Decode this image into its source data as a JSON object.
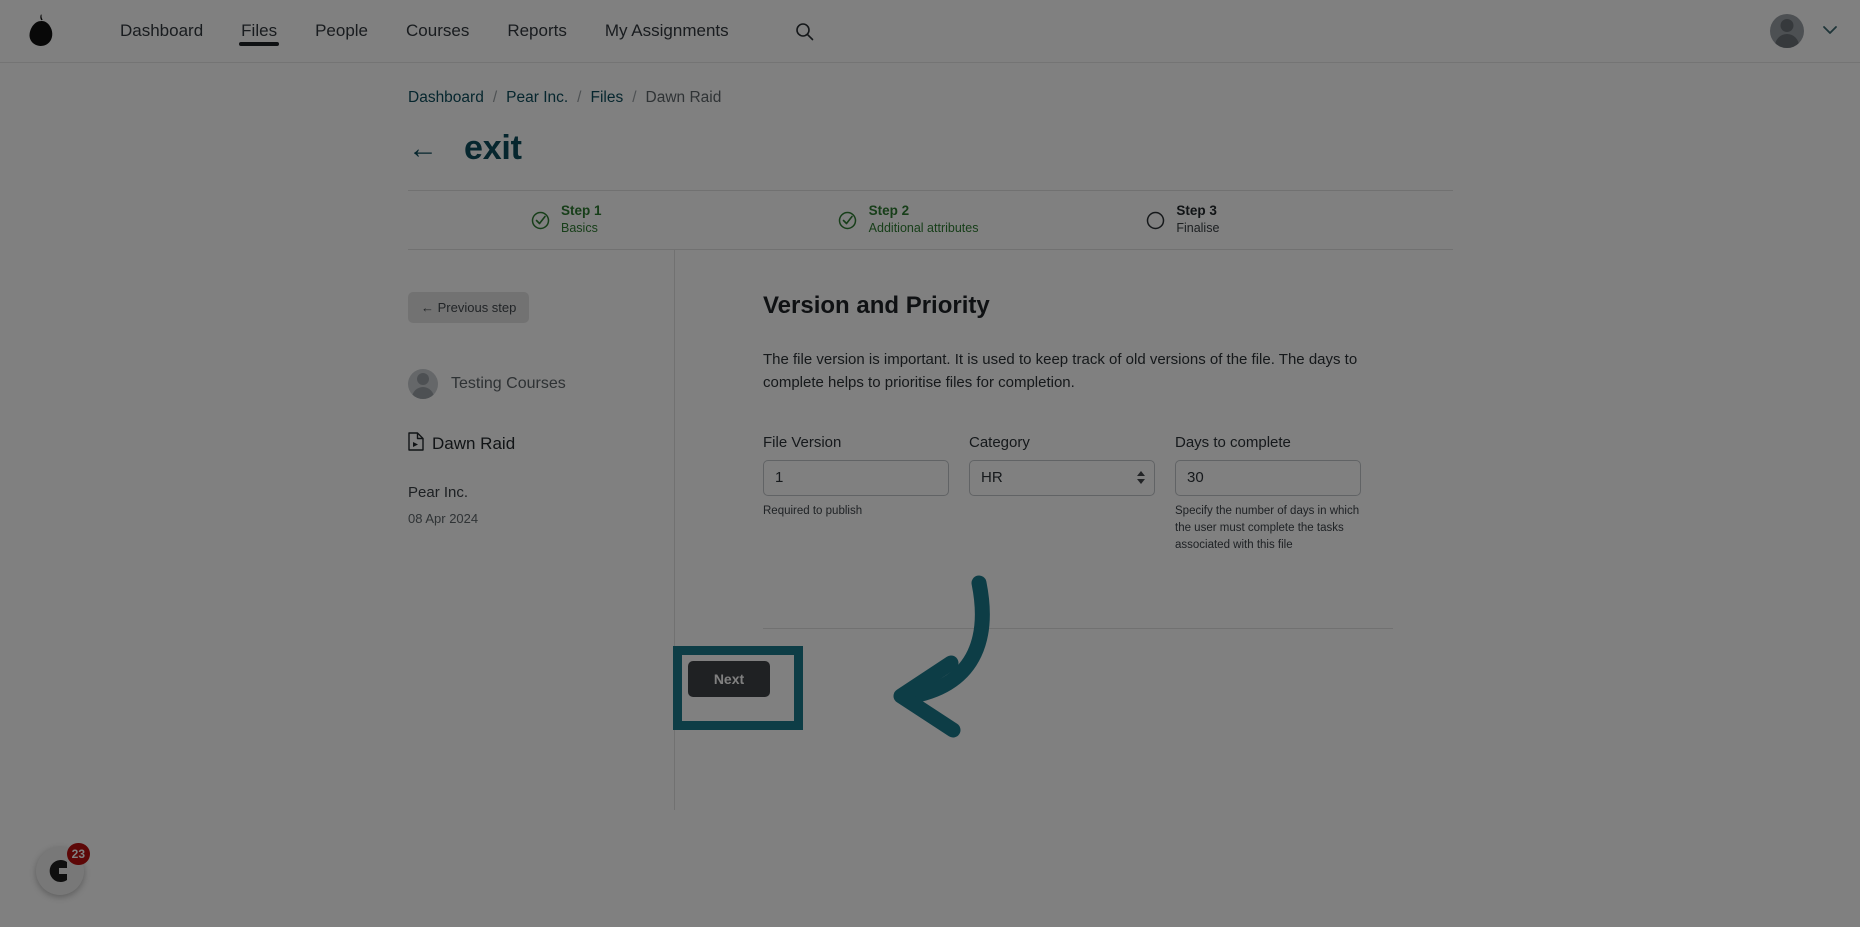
{
  "topnav": {
    "logo_icon": "pear-logo",
    "items": [
      {
        "label": "Dashboard",
        "active": false
      },
      {
        "label": "Files",
        "active": true
      },
      {
        "label": "People",
        "active": false
      },
      {
        "label": "Courses",
        "active": false
      },
      {
        "label": "Reports",
        "active": false
      },
      {
        "label": "My Assignments",
        "active": false
      }
    ],
    "search_icon": "search-icon",
    "account_icon": "user-avatar",
    "account_caret": "chevron-down-icon"
  },
  "breadcrumb": {
    "items": [
      "Dashboard",
      "Pear Inc.",
      "Files",
      "Dawn Raid"
    ],
    "separator": "/"
  },
  "header": {
    "back_arrow": "←",
    "title": "exit"
  },
  "stepper": {
    "steps": [
      {
        "number": "Step 1",
        "label": "Basics",
        "state": "done",
        "icon": "check-circle-icon"
      },
      {
        "number": "Step 2",
        "label": "Additional attributes",
        "state": "done",
        "icon": "check-circle-icon"
      },
      {
        "number": "Step 3",
        "label": "Finalise",
        "state": "todo",
        "icon": "empty-circle-icon"
      }
    ]
  },
  "sidebar": {
    "previous_step_label": "← Previous step",
    "owner_name": "Testing Courses",
    "file_icon": "file-document-icon",
    "file_name": "Dawn Raid",
    "org_name": "Pear Inc.",
    "org_date": "08 Apr 2024"
  },
  "main": {
    "title": "Version and Priority",
    "description": "The file version is important. It is used to keep track of old versions of the file. The days to complete helps to prioritise files for completion.",
    "fields": {
      "file_version": {
        "label": "File Version",
        "value": "1",
        "hint": "Required to publish"
      },
      "category": {
        "label": "Category",
        "value": "HR",
        "options": [
          "HR"
        ],
        "hint": ""
      },
      "days_to_complete": {
        "label": "Days to complete",
        "value": "30",
        "hint": "Specify the number of days in which the user must complete the tasks associated with this file"
      }
    },
    "next_label": "Next"
  },
  "annotation": {
    "highlight_color": "#1b7a8c",
    "arrow_color": "#1b7a8c",
    "target": "next-button"
  },
  "chat_widget": {
    "badge_count": "23",
    "icon": "chat-logo-icon"
  },
  "colors": {
    "accent_teal": "#1b7a8c",
    "link": "#0d4d5c",
    "step_done_green": "#2e7d32",
    "button_dark": "#3f4346",
    "badge_red": "#b90e0e",
    "page_background": "#ffffff"
  }
}
